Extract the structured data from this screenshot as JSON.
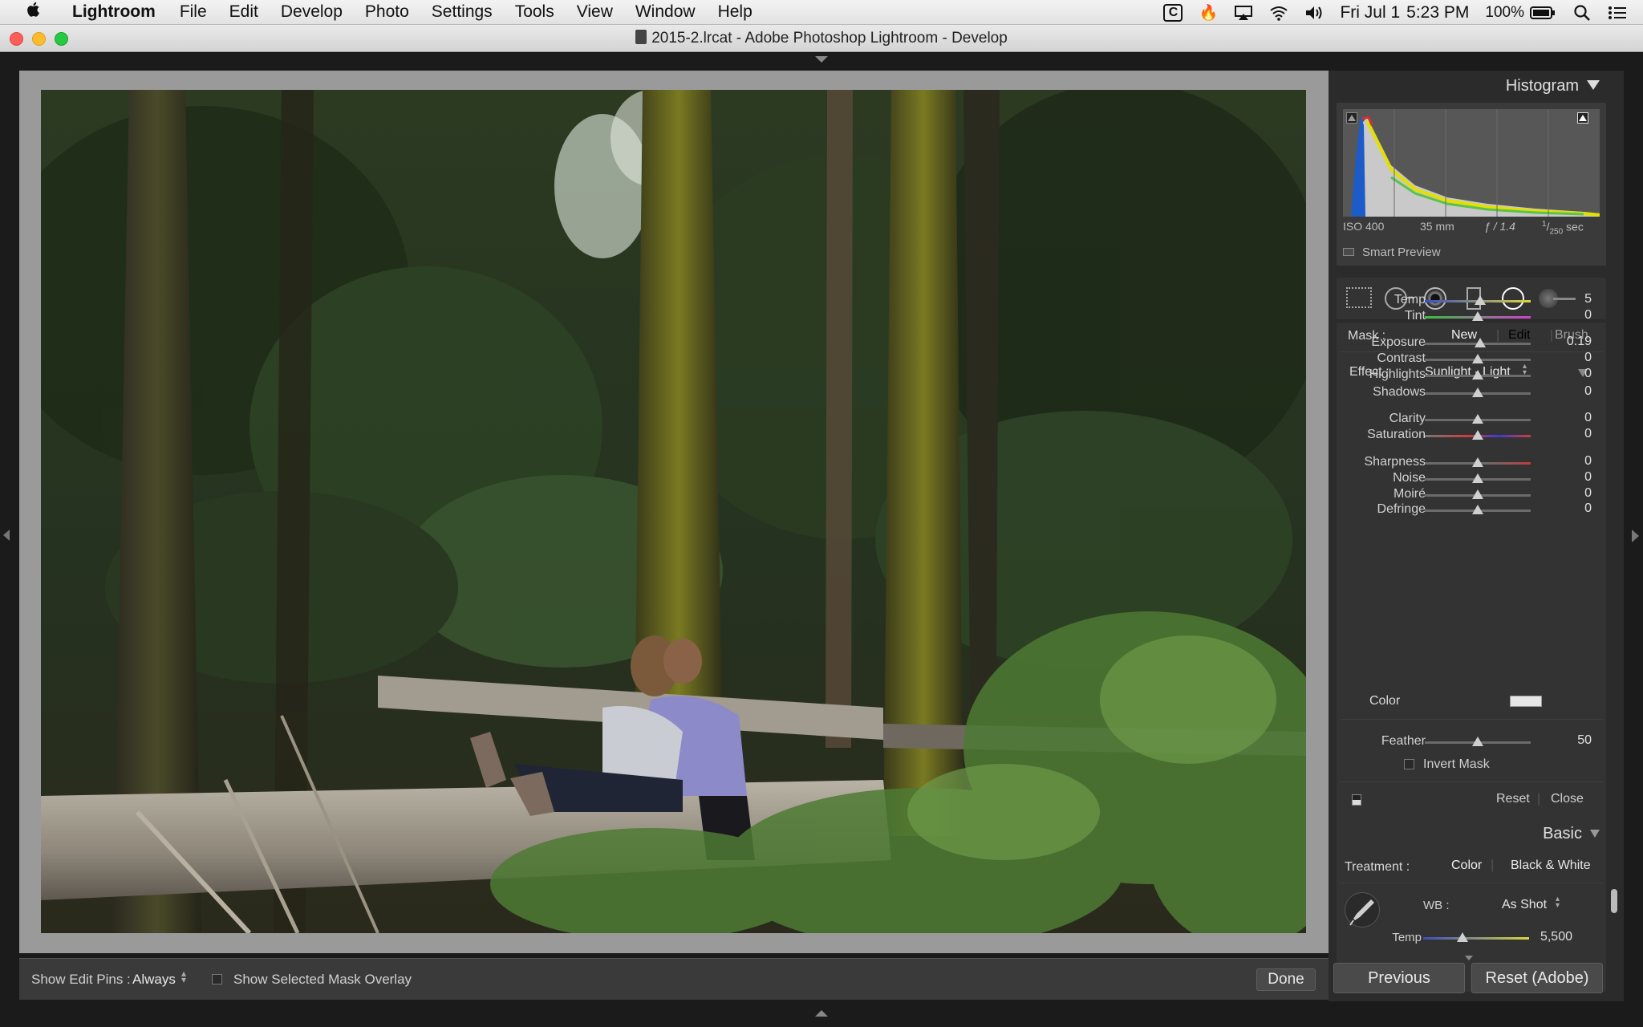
{
  "menubar": {
    "apple": "",
    "app": "Lightroom",
    "items": [
      "File",
      "Edit",
      "Develop",
      "Photo",
      "Settings",
      "Tools",
      "View",
      "Window",
      "Help"
    ],
    "status": {
      "date": "Fri Jul 1",
      "time": "5:23 PM",
      "battery": "100%"
    }
  },
  "window": {
    "title": "2015-2.lrcat - Adobe Photoshop Lightroom - Develop"
  },
  "histogram": {
    "title": "Histogram",
    "iso": "ISO 400",
    "focal": "35 mm",
    "aperture": "ƒ / 1.4",
    "shutter_num": "1",
    "shutter_den": "250",
    "shutter_unit": "sec",
    "smart_preview": "Smart Preview"
  },
  "mask": {
    "label": "Mask :",
    "new": "New",
    "edit": "Edit",
    "brush": "Brush",
    "effect_label": "Effect :",
    "effect_value": "Sunlight - Light",
    "sliders": [
      {
        "label": "Temp",
        "value": "5",
        "pos": 0.52
      },
      {
        "label": "Tint",
        "value": "0",
        "pos": 0.5
      },
      {
        "label": "Exposure",
        "value": "0.19",
        "pos": 0.52
      },
      {
        "label": "Contrast",
        "value": "0",
        "pos": 0.5
      },
      {
        "label": "Highlights",
        "value": "0",
        "pos": 0.5
      },
      {
        "label": "Shadows",
        "value": "0",
        "pos": 0.5
      },
      {
        "label": "Clarity",
        "value": "0",
        "pos": 0.5
      },
      {
        "label": "Saturation",
        "value": "0",
        "pos": 0.5
      },
      {
        "label": "Sharpness",
        "value": "0",
        "pos": 0.5
      },
      {
        "label": "Noise",
        "value": "0",
        "pos": 0.5
      },
      {
        "label": "Moiré",
        "value": "0",
        "pos": 0.5
      },
      {
        "label": "Defringe",
        "value": "0",
        "pos": 0.5
      }
    ],
    "color_label": "Color",
    "feather_label": "Feather",
    "feather_value": "50",
    "feather_pos": 0.5,
    "invert": "Invert Mask",
    "reset": "Reset",
    "close": "Close"
  },
  "basic": {
    "title": "Basic",
    "treatment_label": "Treatment :",
    "color": "Color",
    "bw": "Black & White",
    "wb_label": "WB :",
    "wb_value": "As Shot",
    "temp_label": "Temp",
    "temp_value": "5,500",
    "temp_pos": 0.37
  },
  "toolbar": {
    "pins_label": "Show Edit Pins :",
    "pins_value": "Always",
    "overlay": "Show Selected Mask Overlay",
    "done": "Done"
  },
  "footer": {
    "previous": "Previous",
    "reset": "Reset (Adobe)"
  }
}
